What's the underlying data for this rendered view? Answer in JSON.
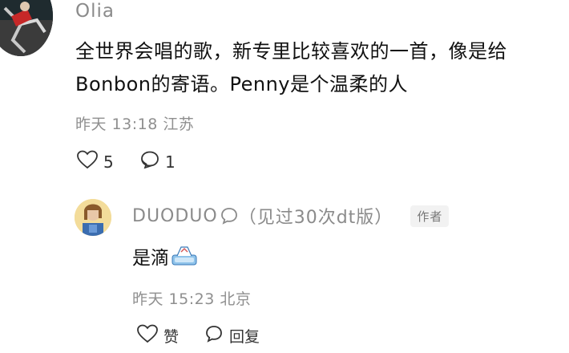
{
  "comment": {
    "username": "Olia",
    "text": "全世界会唱的歌，新专里比较喜欢的一首，像是给Bonbon的寄语。Penny是个温柔的人",
    "time": "昨天 13:18",
    "location": "江苏",
    "likes": "5",
    "replies": "1",
    "like_icon": "heart-outline-icon",
    "reply_icon": "speech-bubble-icon"
  },
  "reply": {
    "username": "DUODUO",
    "name_suffix": "（见过30次dt版）",
    "author_tag": "作者",
    "text": "是滴",
    "time": "昨天 15:23",
    "location": "北京",
    "like_label": "赞",
    "reply_label": "回复"
  },
  "colors": {
    "secondary_text": "#8b8b8b",
    "primary_text": "#111111",
    "tag_bg": "#f2f2f2"
  }
}
